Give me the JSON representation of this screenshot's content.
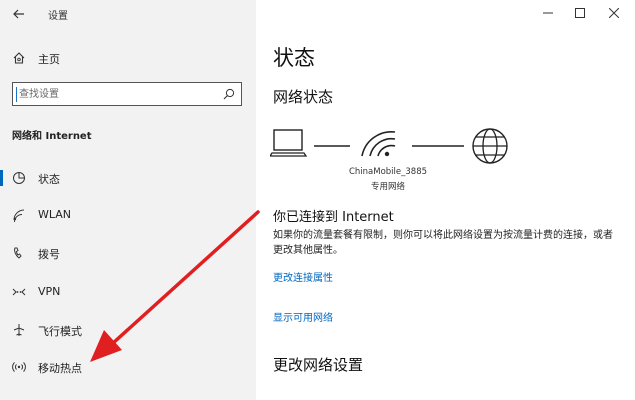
{
  "window": {
    "title": "设置",
    "back_icon": "arrow-left-icon",
    "controls": {
      "minimize_icon": "minimize-icon",
      "maximize_icon": "maximize-icon",
      "close_icon": "close-icon"
    }
  },
  "sidebar": {
    "home": {
      "label": "主页",
      "icon": "home-icon"
    },
    "search": {
      "placeholder": "查找设置",
      "icon": "search-icon"
    },
    "section_heading": "网络和 Internet",
    "items": [
      {
        "label": "状态",
        "icon": "status-icon",
        "selected": true
      },
      {
        "label": "WLAN",
        "icon": "wifi-icon",
        "selected": false
      },
      {
        "label": "拨号",
        "icon": "dialup-icon",
        "selected": false
      },
      {
        "label": "VPN",
        "icon": "vpn-icon",
        "selected": false
      },
      {
        "label": "飞行模式",
        "icon": "airplane-icon",
        "selected": false
      },
      {
        "label": "移动热点",
        "icon": "hotspot-icon",
        "selected": false
      }
    ]
  },
  "main": {
    "title": "状态",
    "network_status_heading": "网络状态",
    "diagram": {
      "icons": [
        "laptop-icon",
        "wifi-signal-icon",
        "globe-icon"
      ],
      "network_name": "ChinaMobile_3885",
      "network_type": "专用网络"
    },
    "connected_title": "你已连接到 Internet",
    "connected_description": "如果你的流量套餐有限制，则你可以将此网络设置为按流量计费的连接，或者更改其他属性。",
    "links": {
      "change_properties": "更改连接属性",
      "show_available": "显示可用网络"
    },
    "change_settings_heading": "更改网络设置"
  },
  "colors": {
    "sidebar_bg": "#f2f2f2",
    "accent": "#0067c0",
    "annotation_arrow": "#e02020"
  }
}
